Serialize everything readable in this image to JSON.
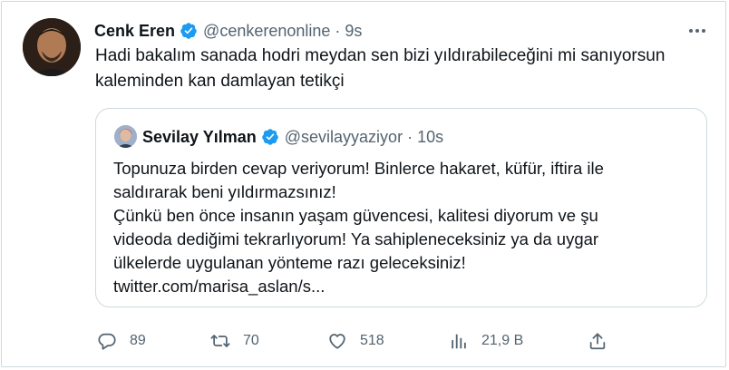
{
  "tweet": {
    "author_name": "Cenk Eren",
    "handle": "@cenkerenonline",
    "separator": "·",
    "time": "9s",
    "text": "Hadi bakalım sanada hodri meydan sen bizi yıldırabileceğini mi sanıyorsun kaleminden kan damlayan tetikçi"
  },
  "quote": {
    "author_name": "Sevilay Yılman",
    "handle": "@sevilayyaziyor",
    "separator": "·",
    "time": "10s",
    "lines": [
      "Topunuza birden cevap veriyorum! Binlerce hakaret, küfür, iftira ile",
      "saldırarak beni yıldırmazsınız!",
      "Çünkü ben önce insanın yaşam güvencesi, kalitesi diyorum ve şu",
      "videoda dediğimi tekrarlıyorum! Ya sahipleneceksiniz ya da uygar",
      "ülkelerde uygulanan yönteme razı geleceksiniz!",
      "twitter.com/marisa_aslan/s..."
    ]
  },
  "actions": {
    "replies": "89",
    "retweets": "70",
    "likes": "518",
    "views": "21,9 B"
  },
  "icons": {
    "verified": "verified-badge-icon",
    "more": "more-icon",
    "reply": "reply-icon",
    "retweet": "retweet-icon",
    "like": "heart-icon",
    "views": "analytics-icon",
    "share": "share-icon"
  },
  "colors": {
    "verified_blue": "#1d9bf0",
    "text_primary": "#0f1419",
    "text_secondary": "#536471",
    "border": "#cfd9de"
  }
}
